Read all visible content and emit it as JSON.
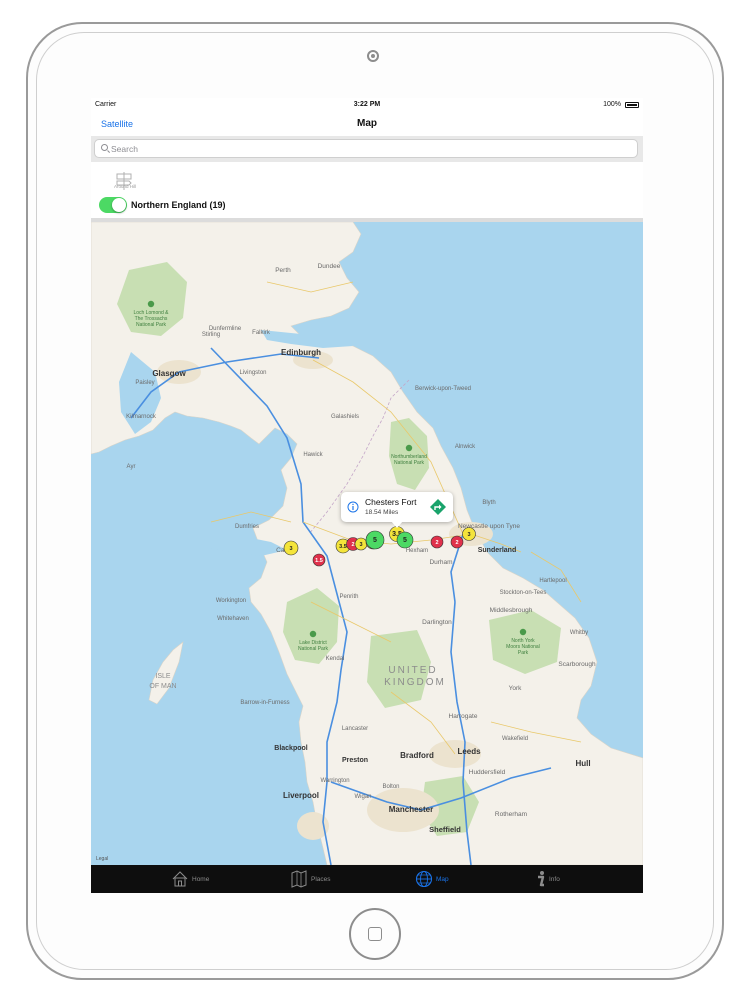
{
  "status_bar": {
    "carrier": "Carrier",
    "time": "3:22 PM",
    "battery": "100%"
  },
  "nav": {
    "left_button": "Satellite",
    "title": "Map"
  },
  "search": {
    "placeholder": "Search"
  },
  "filter": {
    "icon": "road-sign-icon",
    "icon_label": "Around Hill",
    "toggle_on": true,
    "label": "Northern England (19)"
  },
  "map": {
    "country_label_1": "UNITED",
    "country_label_2": "KINGDOM",
    "isle_label_1": "ISLE",
    "isle_label_2": "OF MAN",
    "legal": "Legal",
    "callout": {
      "title": "Chesters Fort",
      "subtitle": "18.54 Miles",
      "info_icon": "info-icon",
      "directions_icon": "directions-icon"
    },
    "cities": [
      "Glasgow",
      "Edinburgh",
      "Newcastle upon Tyne",
      "Sunderland",
      "Middlesbrough",
      "Carlisle",
      "Liverpool",
      "Manchester",
      "Sheffield",
      "Leeds",
      "Bradford",
      "Preston",
      "Blackpool",
      "Hull",
      "York",
      "Perth",
      "Dundee",
      "Stirling",
      "Falkirk",
      "Darlington",
      "Kendal",
      "Harrogate",
      "Wakefield",
      "Huddersfield",
      "Bolton",
      "Wigan",
      "Warrington",
      "Rotherham",
      "Scarborough",
      "Whitby",
      "Penrith",
      "Workington",
      "Whitehaven",
      "Barrow-in-Furness",
      "Lancaster",
      "Dunfermline",
      "Livingston",
      "Paisley",
      "Kilmarnock",
      "Ayr",
      "Dumfries",
      "Hexham",
      "Galashiels",
      "Hawick",
      "Berwick-upon-Tweed",
      "Alnwick",
      "Durham",
      "Hartlepool",
      "Stockton-on-Tees",
      "Blyth"
    ],
    "national_parks": [
      "Loch Lomond & The Trossachs National Park",
      "Northumberland National Park",
      "Lake District National Park",
      "North York Moors National Park"
    ],
    "markers": [
      {
        "label": "3",
        "color": "#f4e43a"
      },
      {
        "label": "1.5",
        "color": "#e0314b"
      },
      {
        "label": "3.5",
        "color": "#f4e43a"
      },
      {
        "label": "2",
        "color": "#e0314b"
      },
      {
        "label": "3",
        "color": "#f4e43a"
      },
      {
        "label": "3.5",
        "color": "#f4e43a"
      },
      {
        "label": "5",
        "color": "#4cd964"
      },
      {
        "label": "3.5",
        "color": "#f4e43a"
      },
      {
        "label": "5",
        "color": "#4cd964"
      },
      {
        "label": "2",
        "color": "#e0314b"
      },
      {
        "label": "2",
        "color": "#e0314b"
      },
      {
        "label": "3",
        "color": "#f4e43a"
      }
    ]
  },
  "tabs": [
    {
      "label": "Home",
      "icon": "home-icon",
      "active": false
    },
    {
      "label": "Places",
      "icon": "map-book-icon",
      "active": false
    },
    {
      "label": "Map",
      "icon": "globe-icon",
      "active": true
    },
    {
      "label": "Info",
      "icon": "info-icon",
      "active": false
    }
  ],
  "colors": {
    "accent": "#1a73e8",
    "toggle": "#4cd964",
    "water": "#a9d5ee",
    "land": "#f4f1ea",
    "park": "#c8dfb3"
  }
}
